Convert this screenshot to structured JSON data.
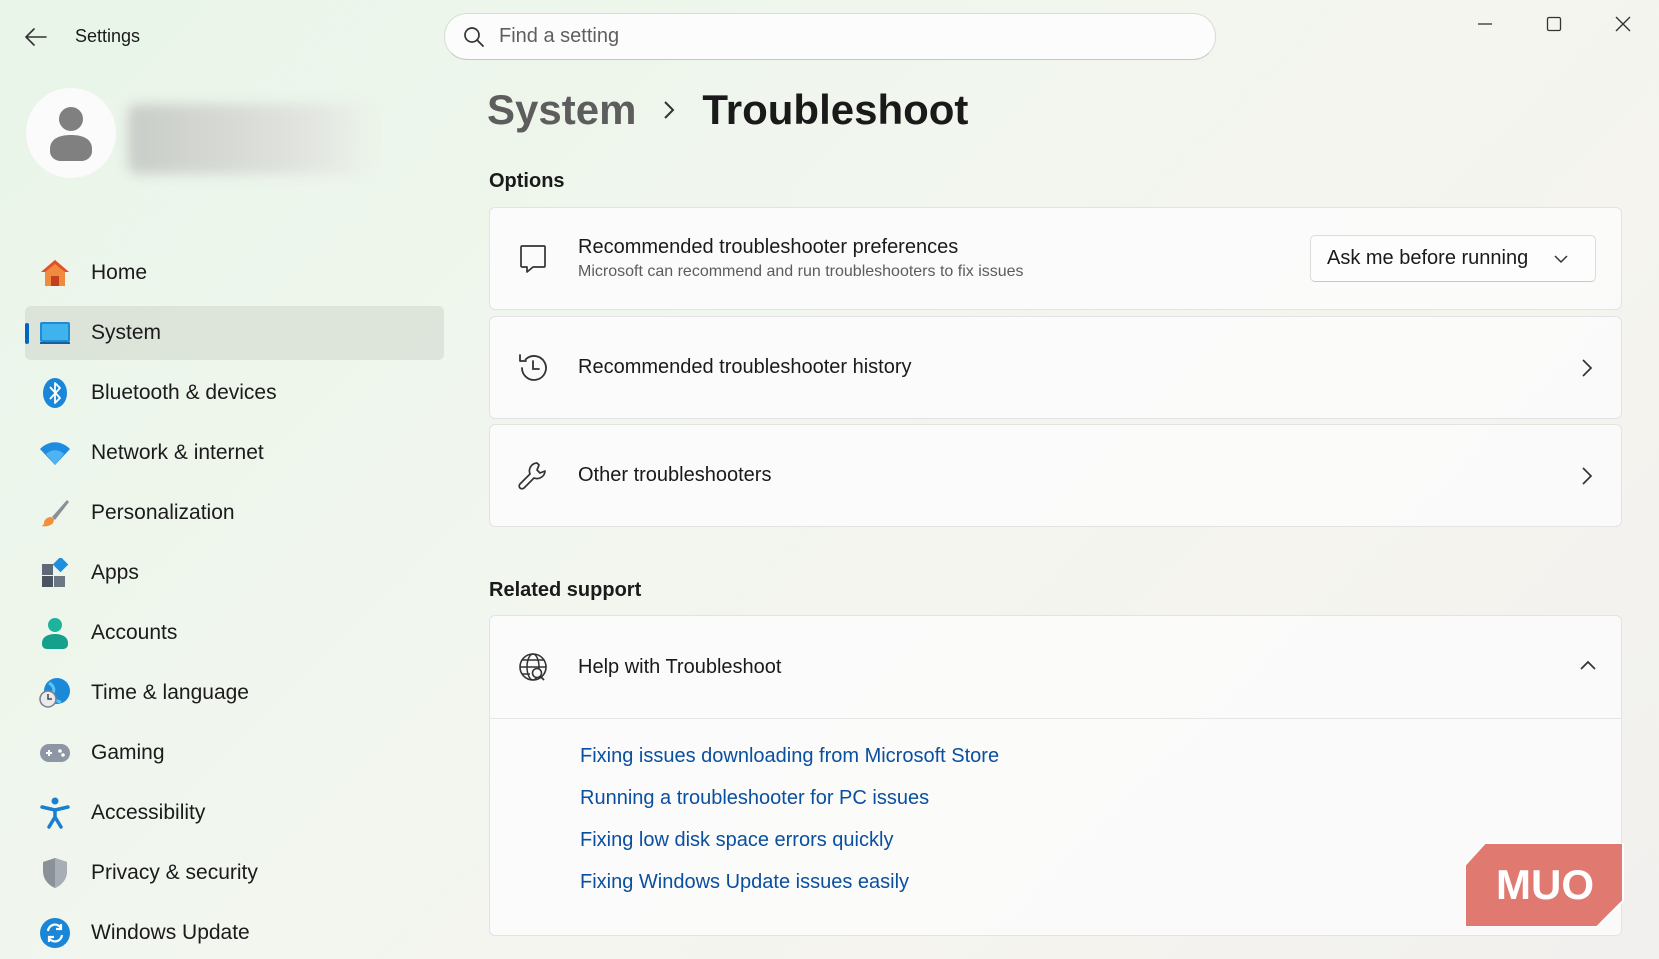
{
  "window": {
    "title": "Settings"
  },
  "search": {
    "placeholder": "Find a setting"
  },
  "profile": {
    "name": ""
  },
  "sidebar": {
    "items": [
      {
        "label": "Home",
        "icon": "home-icon"
      },
      {
        "label": "System",
        "icon": "system-icon",
        "selected": true
      },
      {
        "label": "Bluetooth & devices",
        "icon": "bluetooth-icon"
      },
      {
        "label": "Network & internet",
        "icon": "wifi-icon"
      },
      {
        "label": "Personalization",
        "icon": "brush-icon"
      },
      {
        "label": "Apps",
        "icon": "apps-icon"
      },
      {
        "label": "Accounts",
        "icon": "accounts-icon"
      },
      {
        "label": "Time & language",
        "icon": "time-language-icon"
      },
      {
        "label": "Gaming",
        "icon": "gamepad-icon"
      },
      {
        "label": "Accessibility",
        "icon": "accessibility-icon"
      },
      {
        "label": "Privacy & security",
        "icon": "shield-icon"
      },
      {
        "label": "Windows Update",
        "icon": "update-icon"
      }
    ]
  },
  "breadcrumb": {
    "parent": "System",
    "current": "Troubleshoot"
  },
  "options": {
    "heading": "Options",
    "preferences": {
      "title": "Recommended troubleshooter preferences",
      "subtitle": "Microsoft can recommend and run troubleshooters to fix issues",
      "dropdown_value": "Ask me before running"
    },
    "history": {
      "title": "Recommended troubleshooter history"
    },
    "other": {
      "title": "Other troubleshooters"
    }
  },
  "related": {
    "heading": "Related support",
    "help_title": "Help with Troubleshoot",
    "links": [
      "Fixing issues downloading from Microsoft Store",
      "Running a troubleshooter for PC issues",
      "Fixing low disk space errors quickly",
      "Fixing Windows Update issues easily"
    ]
  },
  "watermark": {
    "text": "MUO"
  },
  "colors": {
    "accent": "#0067c0",
    "link": "#0a4fa0",
    "watermark": "#e07a70"
  }
}
